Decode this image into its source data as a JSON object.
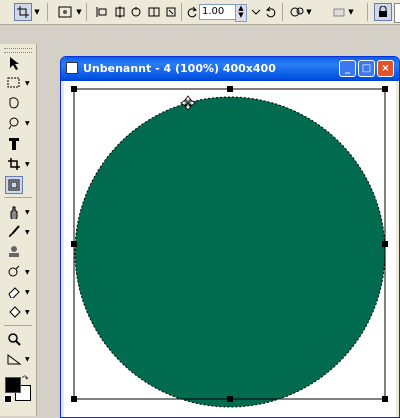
{
  "toolbar": {
    "zoom_value": "1.00",
    "icons": [
      "crop-tool-icon",
      "deform-icon",
      "align-left-icon",
      "align-center-icon",
      "rotate-icon",
      "flip-icon",
      "reset-icon",
      "rotate-left-icon",
      "rotate-right-icon",
      "options-icon",
      "layer-icon",
      "lock-icon"
    ]
  },
  "toolbox": {
    "tools": [
      "arrow-tool",
      "selection-tool",
      "freehand-selection-tool",
      "magic-wand-tool",
      "text-tool",
      "crop-tool",
      "deform-tool",
      "dropper-tool",
      "brush-tool",
      "clone-tool",
      "retouch-tool",
      "eraser-tool",
      "paint-bucket-tool",
      "zoom-tool",
      "straighten-tool"
    ]
  },
  "window": {
    "title": "Unbenannt - 4 (100%) 400x400",
    "minimize": "_",
    "maximize": "□",
    "close": "×"
  },
  "canvas": {
    "shape": "circle",
    "fill_color": "#006b4f",
    "selection": "marquee"
  },
  "colors": {
    "foreground": "#000000",
    "background": "#ffffff",
    "titlebar": "#0a5ee6"
  }
}
